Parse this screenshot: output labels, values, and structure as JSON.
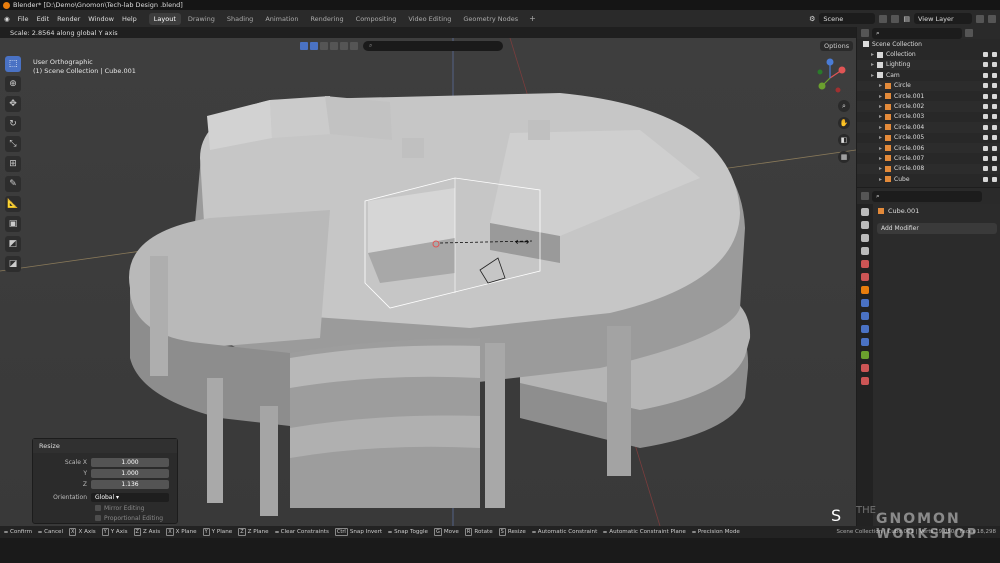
{
  "window_title": "Blender* [D:\\Demo\\Gnomon\\Tech-lab Design .blend]",
  "menu": [
    "File",
    "Edit",
    "Render",
    "Window",
    "Help"
  ],
  "workspaces": [
    "Layout",
    "Drawing",
    "Shading",
    "Animation",
    "Rendering",
    "Compositing",
    "Video Editing",
    "Geometry Nodes"
  ],
  "scene_name": "Scene",
  "view_layer": "View Layer",
  "transform_status": "Scale: 2.8564 along global Y axis",
  "viewport": {
    "mode_label": "User Orthographic",
    "collection_path": "(1) Scene Collection | Cube.001",
    "options_label": "Options"
  },
  "redo_panel": {
    "title": "Resize",
    "scale_x_label": "Scale X",
    "scale_x": "1.000",
    "scale_y_label": "Y",
    "scale_y": "1.000",
    "scale_z_label": "Z",
    "scale_z": "1.136",
    "orientation_label": "Orientation",
    "orientation": "Global",
    "mirror_editing": "Mirror Editing",
    "proportional_editing": "Proportional Editing"
  },
  "outliner": {
    "title": "Scene Collection",
    "items": [
      {
        "name": "Collection",
        "color": "#d8d8d8"
      },
      {
        "name": "Lighting",
        "color": "#d8d8d8"
      },
      {
        "name": "Cam",
        "color": "#d8d8d8"
      },
      {
        "name": "Circle",
        "color": "#e38a3a"
      },
      {
        "name": "Circle.001",
        "color": "#e38a3a"
      },
      {
        "name": "Circle.002",
        "color": "#e38a3a"
      },
      {
        "name": "Circle.003",
        "color": "#e38a3a"
      },
      {
        "name": "Circle.004",
        "color": "#e38a3a"
      },
      {
        "name": "Circle.005",
        "color": "#e38a3a"
      },
      {
        "name": "Circle.006",
        "color": "#e38a3a"
      },
      {
        "name": "Circle.007",
        "color": "#e38a3a"
      },
      {
        "name": "Circle.008",
        "color": "#e38a3a"
      },
      {
        "name": "Cube",
        "color": "#e38a3a"
      }
    ]
  },
  "properties": {
    "object_name": "Cube.001",
    "add_modifier": "Add Modifier"
  },
  "statusbar": [
    {
      "key": "",
      "label": "Confirm"
    },
    {
      "key": "",
      "label": "Cancel"
    },
    {
      "key": "X",
      "label": "X Axis"
    },
    {
      "key": "Y",
      "label": "Y Axis"
    },
    {
      "key": "Z",
      "label": "Z Axis"
    },
    {
      "key": "X",
      "label": "X Plane"
    },
    {
      "key": "Y",
      "label": "Y Plane"
    },
    {
      "key": "Z",
      "label": "Z Plane"
    },
    {
      "key": "",
      "label": "Clear Constraints"
    },
    {
      "key": "Ctrl",
      "label": "Snap Invert"
    },
    {
      "key": "",
      "label": "Snap Toggle"
    },
    {
      "key": "G",
      "label": "Move"
    },
    {
      "key": "R",
      "label": "Rotate"
    },
    {
      "key": "S",
      "label": "Resize"
    },
    {
      "key": "",
      "label": "Automatic Constraint"
    },
    {
      "key": "",
      "label": "Automatic Constraint Plane"
    },
    {
      "key": "",
      "label": "Precision Mode"
    }
  ],
  "status_stats": "Scene Collection | Cube.001 | Verts 19,050 | Faces 18,298",
  "key_overlay": "S",
  "watermark": {
    "line1": "GNOMON",
    "line2": "WORKSHOP",
    "prefix": "THE"
  }
}
